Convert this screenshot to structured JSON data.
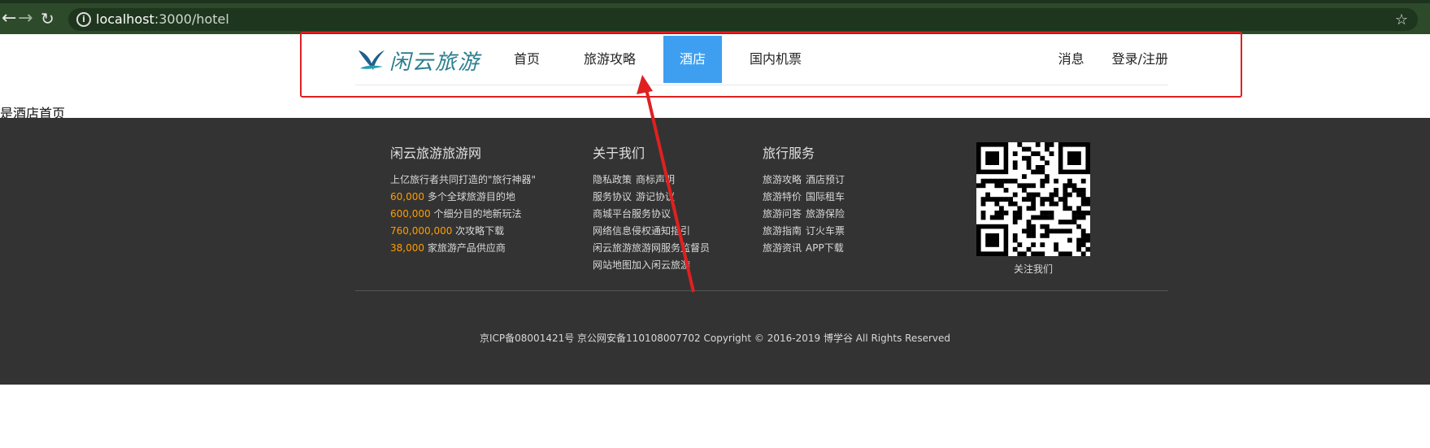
{
  "browser": {
    "url_host": "localhost",
    "url_path": ":3000/hotel"
  },
  "header": {
    "logo_text": "闲云旅游",
    "nav": [
      "首页",
      "旅游攻略",
      "酒店",
      "国内机票"
    ],
    "active_index": 2,
    "messages": "消息",
    "login": "登录/注册"
  },
  "page_text": "是酒店首页",
  "footer": {
    "col1": {
      "title": "闲云旅游旅游网",
      "intro": "上亿旅行者共同打造的\"旅行神器\"",
      "stats": [
        {
          "num": "60,000",
          "text": " 多个全球旅游目的地"
        },
        {
          "num": "600,000",
          "text": " 个细分目的地新玩法"
        },
        {
          "num": "760,000,000",
          "text": " 次攻略下载"
        },
        {
          "num": "38,000",
          "text": " 家旅游产品供应商"
        }
      ]
    },
    "col2": {
      "title": "关于我们",
      "links": [
        [
          "隐私政策",
          "商标声明"
        ],
        [
          "服务协议",
          "游记协议"
        ],
        [
          "商城平台服务协议"
        ],
        [
          "网络信息侵权通知指引"
        ],
        [
          "闲云旅游旅游网服务监督员"
        ],
        [
          "网站地图加入闲云旅游"
        ]
      ]
    },
    "col3": {
      "title": "旅行服务",
      "links": [
        [
          "旅游攻略",
          "酒店预订"
        ],
        [
          "旅游特价",
          "国际租车"
        ],
        [
          "旅游问答",
          "旅游保险"
        ],
        [
          "旅游指南",
          "订火车票"
        ],
        [
          "旅游资讯",
          "APP下载"
        ]
      ]
    },
    "qr_label": "关注我们",
    "copyright": "京ICP备08001421号 京公网安备110108007702 Copyright © 2016-2019 博学谷 All Rights Reserved"
  },
  "colors": {
    "accent": "#3e9ff0",
    "highlight": "#ff9d00",
    "annotation": "#e02020",
    "footer_bg": "#333333"
  }
}
